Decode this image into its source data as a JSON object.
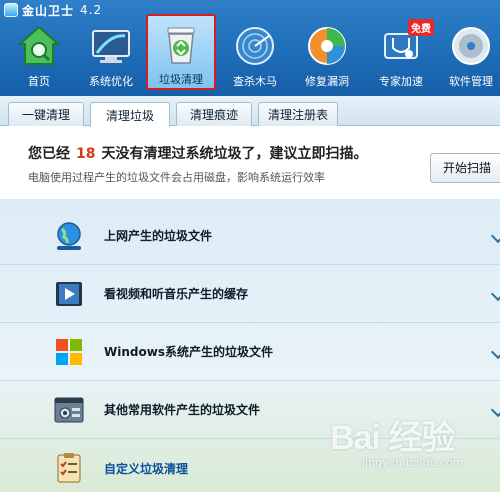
{
  "app": {
    "title": "金山卫士",
    "version": "4.2"
  },
  "nav": [
    {
      "label": "首页",
      "icon": "home-icon"
    },
    {
      "label": "系统优化",
      "icon": "monitor-optimize-icon"
    },
    {
      "label": "垃圾清理",
      "icon": "recycle-bin-icon",
      "active": true
    },
    {
      "label": "查杀木马",
      "icon": "radar-scan-icon"
    },
    {
      "label": "修复漏洞",
      "icon": "disc-repair-icon"
    },
    {
      "label": "专家加速",
      "icon": "stethoscope-icon",
      "badge": "免费"
    },
    {
      "label": "软件管理",
      "icon": "cd-software-icon"
    }
  ],
  "tabs": [
    "一键清理",
    "清理垃圾",
    "清理痕迹",
    "清理注册表"
  ],
  "active_tab": "清理垃圾",
  "scan": {
    "headline_prefix": "您已经",
    "days": "18",
    "headline_suffix": "天没有清理过系统垃圾了，建议立即扫描。",
    "subtext": "电脑使用过程产生的垃圾文件会占用磁盘，影响系统运行效率",
    "button_label": "开始扫描"
  },
  "categories": [
    {
      "label": "上网产生的垃圾文件",
      "icon": "globe-icon"
    },
    {
      "label": "看视频和听音乐产生的缓存",
      "icon": "video-player-icon"
    },
    {
      "label": "Windows系统产生的垃圾文件",
      "icon": "windows-logo-icon"
    },
    {
      "label": "其他常用软件产生的垃圾文件",
      "icon": "settings-window-icon"
    },
    {
      "label": "自定义垃圾清理",
      "icon": "checklist-icon"
    }
  ],
  "watermark": {
    "brand": "Bai 经验",
    "sub": "jingyan.baidu.com"
  },
  "colors": {
    "header_blue": "#1d6bb6",
    "active_border": "#d71d1d",
    "days_accent": "#d33c12"
  }
}
